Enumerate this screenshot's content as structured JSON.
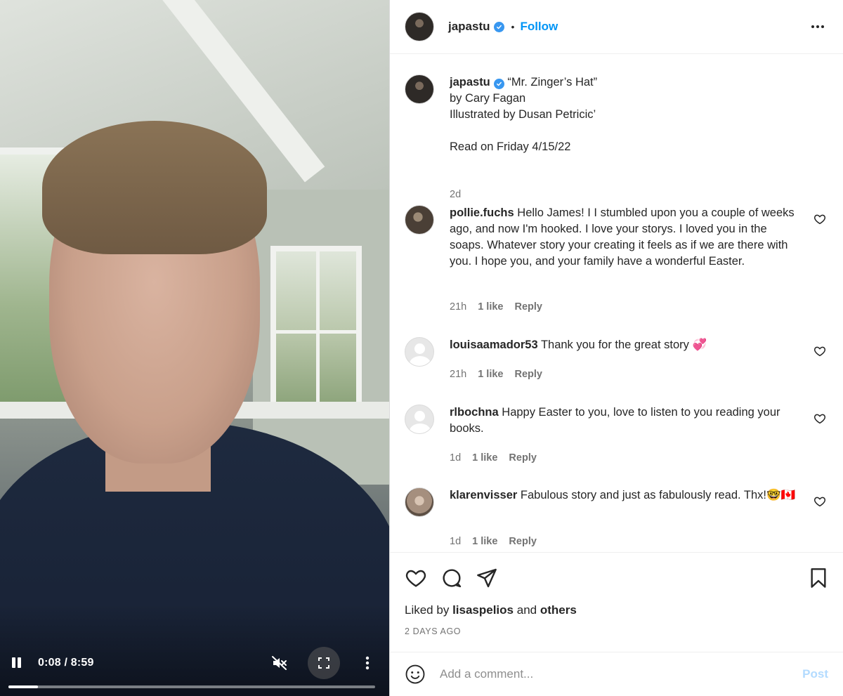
{
  "video": {
    "time": "0:08 / 8:59",
    "progress": 0.015
  },
  "post": {
    "username": "japastu",
    "follow_label": "Follow",
    "dot": "•",
    "caption": {
      "username": "japastu",
      "lines": [
        "“Mr. Zinger’s Hat”",
        "by Cary Fagan",
        "Illustrated by Dusan Petricic’",
        "",
        "Read on Friday 4/15/22"
      ],
      "age": "2d"
    }
  },
  "comments": [
    {
      "username": "pollie.fuchs",
      "text": "Hello James! I I stumbled upon you a couple of weeks ago, and now I'm hooked. I love your storys. I loved you in the soaps. Whatever story your creating it feels as if we are there with you. I hope you, and your family have a wonderful Easter.",
      "time": "21h",
      "likes": "1 like",
      "reply": "Reply"
    },
    {
      "username": "louisaamador53",
      "text": "Thank you for the great story 💞",
      "time": "21h",
      "likes": "1 like",
      "reply": "Reply"
    },
    {
      "username": "rlbochna",
      "text": "Happy Easter to you, love to listen to you reading your books.",
      "time": "1d",
      "likes": "1 like",
      "reply": "Reply"
    },
    {
      "username": "klarenvisser",
      "text": "Fabulous story and just as fabulously read. Thx!🤓🇨🇦",
      "time": "1d",
      "likes": "1 like",
      "reply": "Reply"
    }
  ],
  "footer": {
    "liked_prefix": "Liked by",
    "liked_user": "lisaspelios",
    "liked_and": "and",
    "liked_others": "others",
    "date": "2 DAYS AGO",
    "add_placeholder": "Add a comment...",
    "post_label": "Post"
  },
  "colors": {
    "accent": "#0095f6",
    "verified": "#3897f0",
    "post_disabled": "#b3dbff",
    "muted_text": "#737373"
  },
  "icons": [
    "pause-icon",
    "mute-icon",
    "fullscreen-icon",
    "kebab-icon",
    "verified-icon",
    "more-icon",
    "heart-icon",
    "comment-icon",
    "share-icon",
    "bookmark-icon",
    "emoji-icon"
  ]
}
